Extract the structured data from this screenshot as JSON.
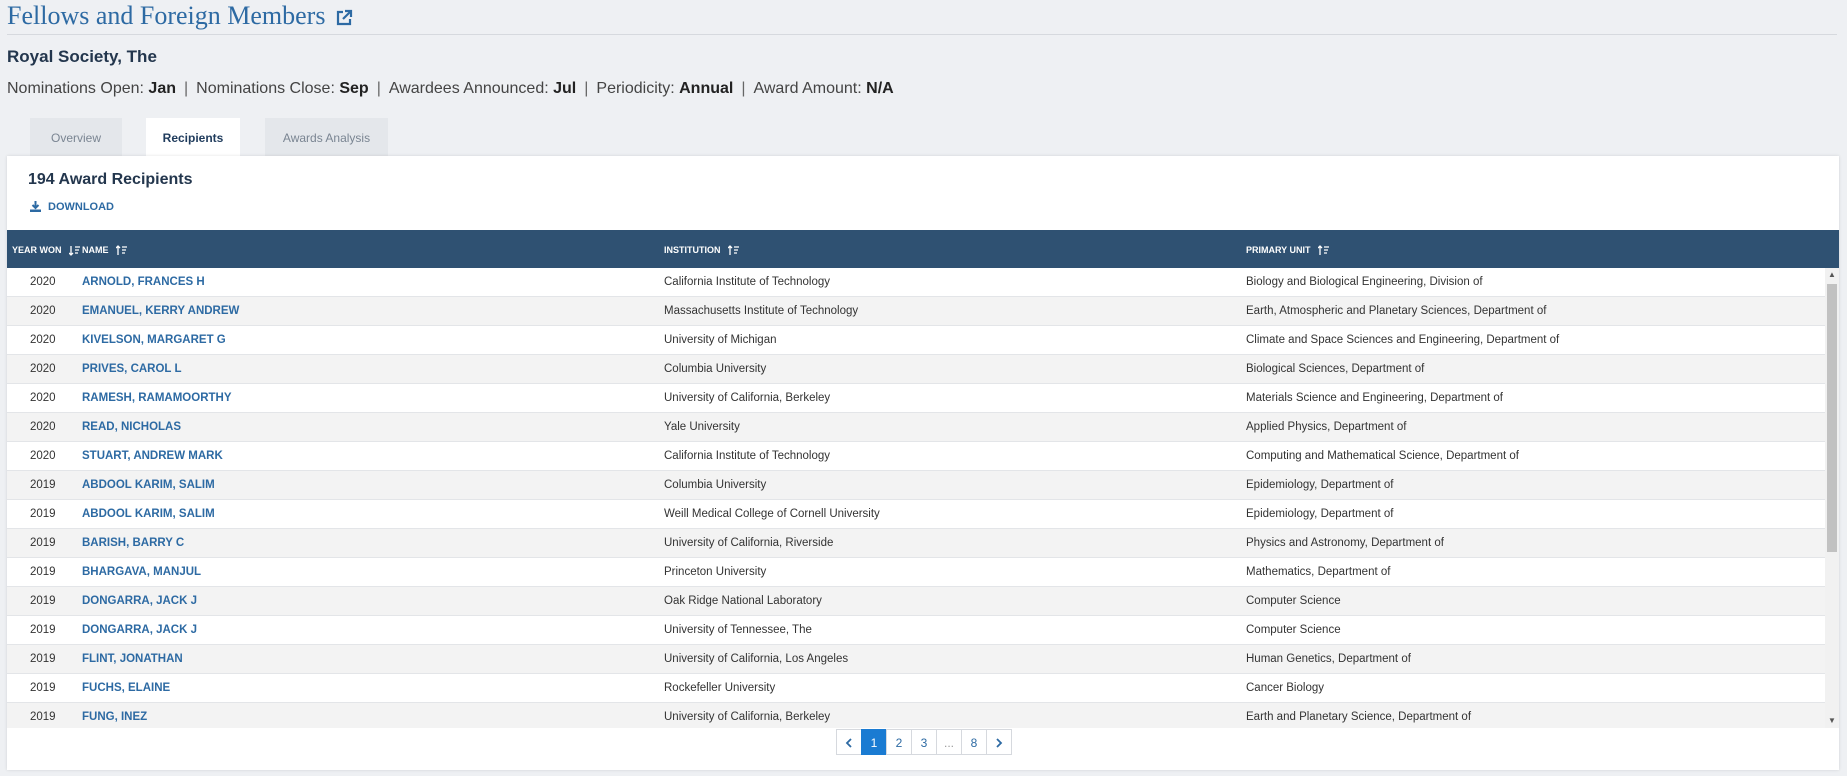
{
  "award": {
    "title": "Fellows and Foreign Members",
    "external_link_icon": "external-link-icon"
  },
  "organization": "Royal Society, The",
  "meta": {
    "nominations_open_label": "Nominations Open:",
    "nominations_open_value": "Jan",
    "nominations_close_label": "Nominations Close:",
    "nominations_close_value": "Sep",
    "awardees_announced_label": "Awardees Announced:",
    "awardees_announced_value": "Jul",
    "periodicity_label": "Periodicity:",
    "periodicity_value": "Annual",
    "award_amount_label": "Award Amount:",
    "award_amount_value": "N/A",
    "separator": "|"
  },
  "tabs": [
    {
      "label": "Overview",
      "active": false
    },
    {
      "label": "Recipients",
      "active": true
    },
    {
      "label": "Awards Analysis",
      "active": false
    }
  ],
  "recipients": {
    "count_title": "194 Award Recipients",
    "download_label": "DOWNLOAD",
    "columns": {
      "year": "YEAR WON",
      "name": "NAME",
      "institution": "INSTITUTION",
      "primary_unit": "PRIMARY UNIT"
    },
    "rows": [
      {
        "year": "2020",
        "name": "ARNOLD, FRANCES H",
        "institution": "California Institute of Technology",
        "unit": "Biology and Biological Engineering, Division of"
      },
      {
        "year": "2020",
        "name": "EMANUEL, KERRY ANDREW",
        "institution": "Massachusetts Institute of Technology",
        "unit": "Earth, Atmospheric and Planetary Sciences, Department of"
      },
      {
        "year": "2020",
        "name": "KIVELSON, MARGARET G",
        "institution": "University of Michigan",
        "unit": "Climate and Space Sciences and Engineering, Department of"
      },
      {
        "year": "2020",
        "name": "PRIVES, CAROL L",
        "institution": "Columbia University",
        "unit": "Biological Sciences, Department of"
      },
      {
        "year": "2020",
        "name": "RAMESH, RAMAMOORTHY",
        "institution": "University of California, Berkeley",
        "unit": "Materials Science and Engineering, Department of"
      },
      {
        "year": "2020",
        "name": "READ, NICHOLAS",
        "institution": "Yale University",
        "unit": "Applied Physics, Department of"
      },
      {
        "year": "2020",
        "name": "STUART, ANDREW MARK",
        "institution": "California Institute of Technology",
        "unit": "Computing and Mathematical Science, Department of"
      },
      {
        "year": "2019",
        "name": "ABDOOL KARIM, SALIM",
        "institution": "Columbia University",
        "unit": "Epidemiology, Department of"
      },
      {
        "year": "2019",
        "name": "ABDOOL KARIM, SALIM",
        "institution": "Weill Medical College of Cornell University",
        "unit": "Epidemiology, Department of"
      },
      {
        "year": "2019",
        "name": "BARISH, BARRY C",
        "institution": "University of California, Riverside",
        "unit": "Physics and Astronomy, Department of"
      },
      {
        "year": "2019",
        "name": "BHARGAVA, MANJUL",
        "institution": "Princeton University",
        "unit": "Mathematics, Department of"
      },
      {
        "year": "2019",
        "name": "DONGARRA, JACK J",
        "institution": "Oak Ridge National Laboratory",
        "unit": "Computer Science"
      },
      {
        "year": "2019",
        "name": "DONGARRA, JACK J",
        "institution": "University of Tennessee, The",
        "unit": "Computer Science"
      },
      {
        "year": "2019",
        "name": "FLINT, JONATHAN",
        "institution": "University of California, Los Angeles",
        "unit": "Human Genetics, Department of"
      },
      {
        "year": "2019",
        "name": "FUCHS, ELAINE",
        "institution": "Rockefeller University",
        "unit": "Cancer Biology"
      },
      {
        "year": "2019",
        "name": "FUNG, INEZ",
        "institution": "University of California, Berkeley",
        "unit": "Earth and Planetary Science, Department of"
      }
    ]
  },
  "pagination": {
    "pages": [
      "1",
      "2",
      "3",
      "...",
      "8"
    ],
    "current": "1",
    "prev_icon": "chevron-left-icon",
    "next_icon": "chevron-right-icon"
  }
}
